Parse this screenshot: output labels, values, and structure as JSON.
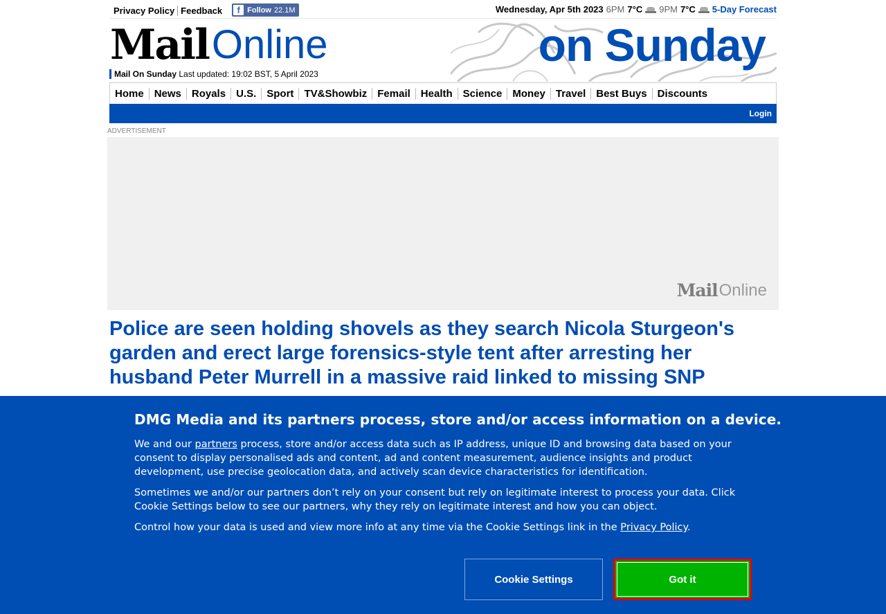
{
  "topbar": {
    "privacy": "Privacy Policy",
    "feedback": "Feedback",
    "fb_follow": "Follow",
    "fb_count": "22.1M",
    "date": "Wednesday, Apr 5th 2023",
    "time1": "6PM",
    "temp1": "7°C",
    "time2": "9PM",
    "temp2": "7°C",
    "forecast": "5-Day Forecast"
  },
  "masthead": {
    "logo_mail": "Mail",
    "logo_online": "Online",
    "edition": "Mail On Sunday",
    "updated": "Last updated: 19:02 BST, 5 April 2023",
    "banner": "on Sunday"
  },
  "nav": {
    "items": [
      "Home",
      "News",
      "Royals",
      "U.S.",
      "Sport",
      "TV&Showbiz",
      "Femail",
      "Health",
      "Science",
      "Money",
      "Travel",
      "Best Buys",
      "Discounts"
    ],
    "login": "Login"
  },
  "ad": {
    "label": "ADVERTISEMENT",
    "logo_mail": "Mail",
    "logo_online": "Online"
  },
  "article": {
    "headline": "Police are seen holding shovels as they search Nicola Sturgeon's garden and erect large forensics-style tent after arresting her husband Peter Murrell in a massive raid linked to missing SNP"
  },
  "consent": {
    "title": "DMG Media and its partners process, store and/or access information on a device.",
    "p1_pre": "We and our ",
    "p1_link": "partners",
    "p1_post": " process, store and/or access data such as IP address, unique ID and browsing data based on your consent to display personalised ads and content, ad and content measurement, audience insights and product development, use precise geolocation data, and actively scan device characteristics for identification.",
    "p2": "Sometimes we and/or our partners don’t rely on your consent but rely on legitimate interest to process your data. Click Cookie Settings below to see our partners, why they rely on legitimate interest and how you can object.",
    "p3_pre": "Control how your data is used and view more info at any time via the Cookie Settings link in the ",
    "p3_link": "Privacy Policy",
    "p3_post": ".",
    "settings_button": "Cookie Settings",
    "ok_button": "Got it"
  },
  "colors": {
    "brand_blue": "#004db3",
    "accept_green": "#00b300",
    "accept_border": "#e60000"
  }
}
